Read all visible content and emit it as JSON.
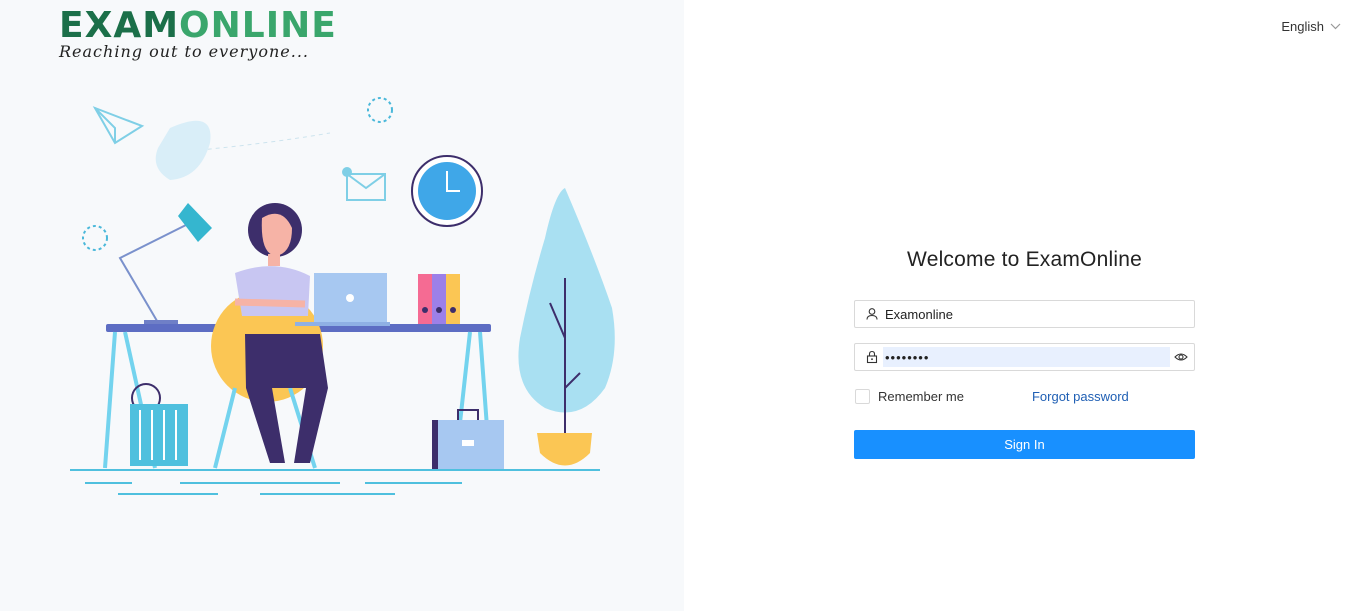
{
  "brand": {
    "logo_part1": "EXAM",
    "logo_part2": "ONLINE",
    "tagline": "Reaching out  to everyone...",
    "colors": {
      "dark_green": "#1b6f49",
      "light_green": "#3aa66c"
    }
  },
  "language": {
    "label": "English",
    "icon": "chevron-down-icon"
  },
  "login": {
    "title": "Welcome to ExamOnline",
    "username_value": "Examonline",
    "password_value": "••••••••",
    "remember_label": "Remember me",
    "remember_checked": false,
    "forgot_label": "Forgot password",
    "submit_label": "Sign In",
    "icons": {
      "username": "user-icon",
      "password": "lock-icon",
      "reveal": "eye-icon"
    },
    "colors": {
      "primary": "#1890ff",
      "link": "#1f5fb4",
      "autofill": "#e8f0fe"
    }
  }
}
